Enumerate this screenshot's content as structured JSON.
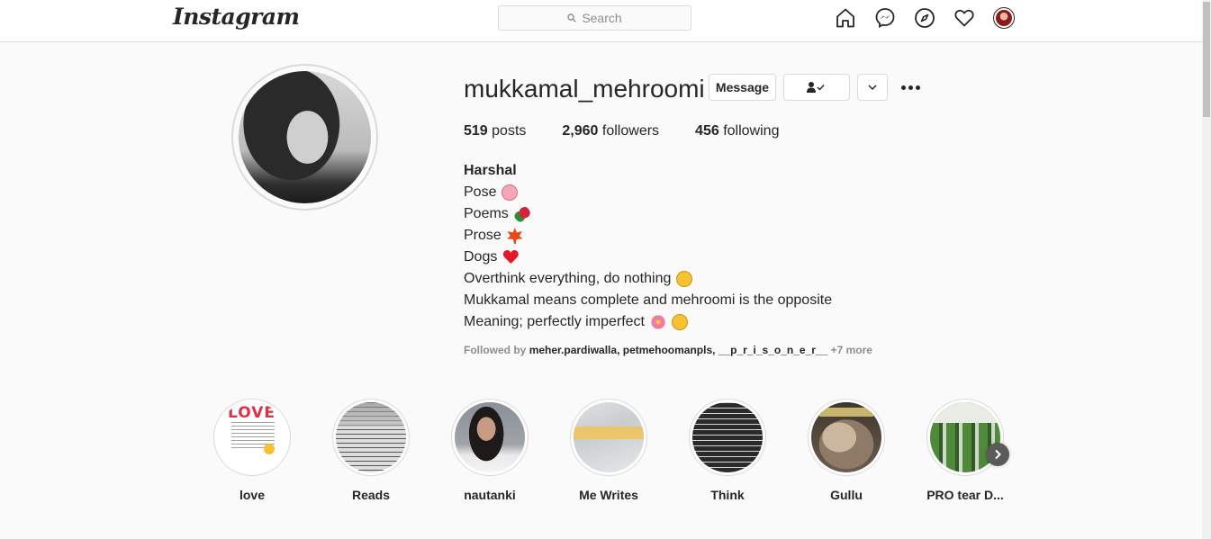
{
  "nav": {
    "logo": "Instagram",
    "search_placeholder": "Search"
  },
  "profile": {
    "username": "mukkamal_mehroomi",
    "message_button": "Message",
    "stats": {
      "posts_count": "519",
      "posts_label": "posts",
      "followers_count": "2,960",
      "followers_label": "followers",
      "following_count": "456",
      "following_label": "following"
    },
    "bio": {
      "name": "Harshal",
      "lines": [
        "Pose",
        "Poems",
        "Prose",
        "Dogs",
        "Overthink everything, do nothing",
        "Mukkamal means complete and mehroomi is the opposite",
        "Meaning; perfectly imperfect"
      ]
    },
    "followed_by": {
      "prefix": "Followed by",
      "names": [
        "meher.pardiwalla",
        "petmehoomanpls",
        "__p_r_i_s_o_n_e_r__"
      ],
      "more": "+7 more"
    }
  },
  "highlights": [
    {
      "label": "love",
      "love_text": "LOVE"
    },
    {
      "label": "Reads"
    },
    {
      "label": "nautanki"
    },
    {
      "label": "Me Writes"
    },
    {
      "label": "Think"
    },
    {
      "label": "Gullu"
    },
    {
      "label": "PRO tear D..."
    }
  ],
  "icons": {
    "nav": [
      "home-icon",
      "messenger-icon",
      "explore-icon",
      "heart-icon",
      "profile-avatar"
    ],
    "buttons": [
      "user-check-icon",
      "chevron-down-icon",
      "more-options-icon",
      "next-arrow-icon"
    ]
  }
}
